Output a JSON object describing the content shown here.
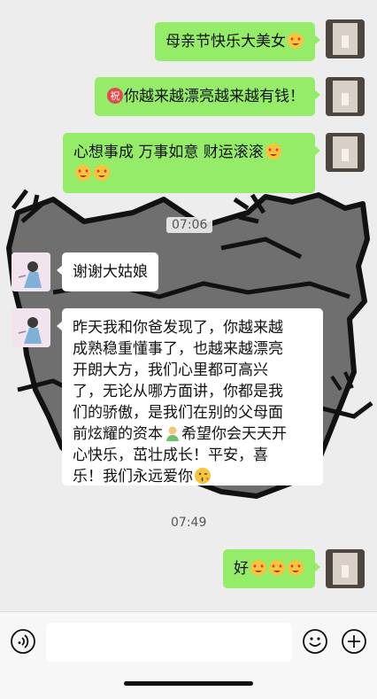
{
  "messages": [
    {
      "side": "me",
      "lines": [
        "母亲节快乐大美女"
      ],
      "trailing_emoji": "heart-eyes"
    },
    {
      "side": "me",
      "lines": [
        "你越来越漂亮越来越有钱！"
      ],
      "leading_emoji": "congratulation-sign"
    },
    {
      "side": "me",
      "lines": [
        "心想事成 万事如意 财运滚滚"
      ],
      "extra_emoji_line": "heart-eyes x2"
    },
    {
      "side": "them",
      "lines": [
        "谢谢大姑娘"
      ]
    },
    {
      "side": "them",
      "lines": [
        "昨天我和你爸发现了，你越来越",
        "成熟稳重懂事了，也越来越漂亮",
        "开朗大方，我们心里都可高兴",
        "了，无论从哪方面讲，你都是我",
        "们的骄傲，是我们在别的父母面",
        "前炫耀的资本",
        "希望你会天天开",
        "心快乐，茁壮成长！平安，喜",
        "乐！我们永远爱你"
      ]
    },
    {
      "side": "me",
      "lines": [
        "好"
      ],
      "trailing_emoji": "heart-eyes x3"
    }
  ],
  "timestamps": {
    "first": "07:06",
    "second": "07:49"
  },
  "input_bar": {
    "voice_icon": "voice-icon",
    "emoji_icon": "emoji-icon",
    "plus_icon": "plus-icon"
  },
  "colors": {
    "my_bubble": "#95ec69",
    "their_bubble": "#ffffff",
    "background": "#ededed"
  }
}
